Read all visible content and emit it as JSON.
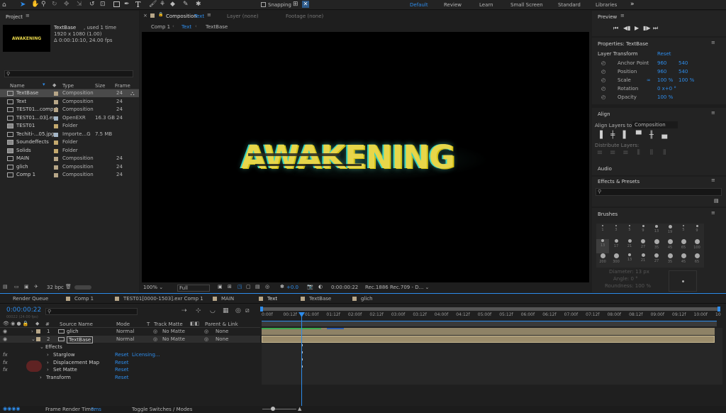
{
  "toolbar": {
    "snapping": "Snapping",
    "workspaces": [
      "Default",
      "Review",
      "Learn",
      "Small Screen",
      "Standard",
      "Libraries"
    ],
    "more": "»"
  },
  "project": {
    "title": "Project",
    "comp_name": "TextBase",
    "used": ", used 1 time",
    "res": "1920 x 1080 (1.00)",
    "dur": "Δ 0:00:10:10, 24.00 fps",
    "thumb_text": "AWAKENING",
    "search_placeholder": "",
    "cols": [
      "Name",
      "Type",
      "Size",
      "Frame R..."
    ],
    "items": [
      {
        "name": "TextBase",
        "type": "Composition",
        "size": "",
        "fr": "24",
        "color": "#b7a688",
        "selected": true
      },
      {
        "name": "Text",
        "type": "Composition",
        "size": "",
        "fr": "24",
        "color": "#b7a688"
      },
      {
        "name": "TEST01...comp 1",
        "type": "Composition",
        "size": "",
        "fr": "24",
        "color": "#b7a688"
      },
      {
        "name": "TEST01...03].exr",
        "type": "OpenEXR",
        "size": "16.3 GB",
        "fr": "24",
        "color": "#a4b6c7"
      },
      {
        "name": "TEST01",
        "type": "Folder",
        "size": "",
        "fr": "",
        "color": "#c4a96e"
      },
      {
        "name": "Techiti-...05.jpg",
        "type": "Importe...G",
        "size": "7.5 MB",
        "fr": "",
        "color": "#a4b6c7"
      },
      {
        "name": "Soundeffects",
        "type": "Folder",
        "size": "",
        "fr": "",
        "color": "#c4a96e"
      },
      {
        "name": "Solids",
        "type": "Folder",
        "size": "",
        "fr": "",
        "color": "#c4a96e"
      },
      {
        "name": "MAIN",
        "type": "Composition",
        "size": "",
        "fr": "24",
        "color": "#b7a688"
      },
      {
        "name": "glich",
        "type": "Composition",
        "size": "",
        "fr": "24",
        "color": "#b7a688"
      },
      {
        "name": "Comp 1",
        "type": "Composition",
        "size": "",
        "fr": "24",
        "color": "#b7a688"
      }
    ],
    "bpc": "32 bpc"
  },
  "viewer": {
    "tab_comp": "Composition",
    "tab_comp_name": "Text",
    "tab_layer": "Layer (none)",
    "tab_footage": "Footage (none)",
    "crumbs": [
      "Comp 1",
      "Text",
      "TextBase"
    ],
    "title": "AWAKENING",
    "zoom": "100%",
    "quality": "Full",
    "exposure": "+0.0",
    "time": "0:00:00:22",
    "color_space": "Rec.1886 Rec.709 - D..."
  },
  "preview": {
    "title": "Preview"
  },
  "properties": {
    "title": "Properties: TextBase",
    "section": "Layer Transform",
    "reset": "Reset",
    "rows": [
      {
        "label": "Anchor Point",
        "v1": "960",
        "v2": "540"
      },
      {
        "label": "Position",
        "v1": "960",
        "v2": "540"
      },
      {
        "label": "Scale",
        "v1": "100 %",
        "v2": "100 %"
      },
      {
        "label": "Rotation",
        "v1": "0 x+0 °",
        "v2": ""
      },
      {
        "label": "Opacity",
        "v1": "100 %",
        "v2": ""
      }
    ]
  },
  "align": {
    "title": "Align",
    "align_to_label": "Align Layers to:",
    "align_to": "Composition",
    "distribute": "Distribute Layers:"
  },
  "audio": {
    "title": "Audio"
  },
  "effects": {
    "title": "Effects & Presets",
    "placeholder": ""
  },
  "brushes": {
    "title": "Brushes",
    "sizes": [
      "1",
      "3",
      "5",
      "9",
      "13",
      "19",
      "5",
      "9",
      "13",
      "17",
      "21",
      "27",
      "35",
      "45",
      "65",
      "100",
      "200",
      "300",
      "13",
      "21",
      "27",
      "35",
      "45",
      "65"
    ],
    "diameter": "Diameter: 13 px",
    "angle": "Angle: 0 °",
    "roundness": "Roundness: 100 %"
  },
  "timeline": {
    "tabs": [
      "Render Queue",
      "Comp 1",
      "TEST01[0000-1503].exr Comp 1",
      "MAIN",
      "Text",
      "TextBase",
      "glich"
    ],
    "active_tab": "Text",
    "timecode": "0:00:00:22",
    "timecode_sub": "00022 (24.00 fps)",
    "col_headers": {
      "num": "#",
      "source": "Source Name",
      "mode": "Mode",
      "t": "T",
      "matte": "Track Matte",
      "parent": "Parent & Link"
    },
    "layers": [
      {
        "num": "1",
        "name": "glich",
        "mode": "Normal",
        "matte": "No Matte",
        "parent": "None"
      },
      {
        "num": "2",
        "name": "TextBase",
        "mode": "Normal",
        "matte": "No Matte",
        "parent": "None"
      }
    ],
    "effects_label": "Effects",
    "effect_rows": [
      {
        "name": "Starglow",
        "reset": "Reset",
        "extra": "Licensing..."
      },
      {
        "name": "Displacement Map",
        "reset": "Reset",
        "extra": ""
      },
      {
        "name": "Set Matte",
        "reset": "Reset",
        "extra": ""
      }
    ],
    "transform": {
      "name": "Transform",
      "reset": "Reset"
    },
    "ruler": [
      "0:00f",
      "00:12f",
      "01:00f",
      "01:12f",
      "02:00f",
      "02:12f",
      "03:00f",
      "03:12f",
      "04:00f",
      "04:12f",
      "05:00f",
      "05:12f",
      "06:00f",
      "06:12f",
      "07:00f",
      "07:12f",
      "08:00f",
      "08:12f",
      "09:00f",
      "09:12f",
      "10:00f",
      "10"
    ],
    "footer_label": "Frame Render Time:",
    "footer_value": "0ms",
    "toggle": "Toggle Switches / Modes"
  },
  "colors": {
    "accent": "#2d8ceb",
    "layer_bar": "#8e8266",
    "title_yellow": "#e7d64a"
  }
}
